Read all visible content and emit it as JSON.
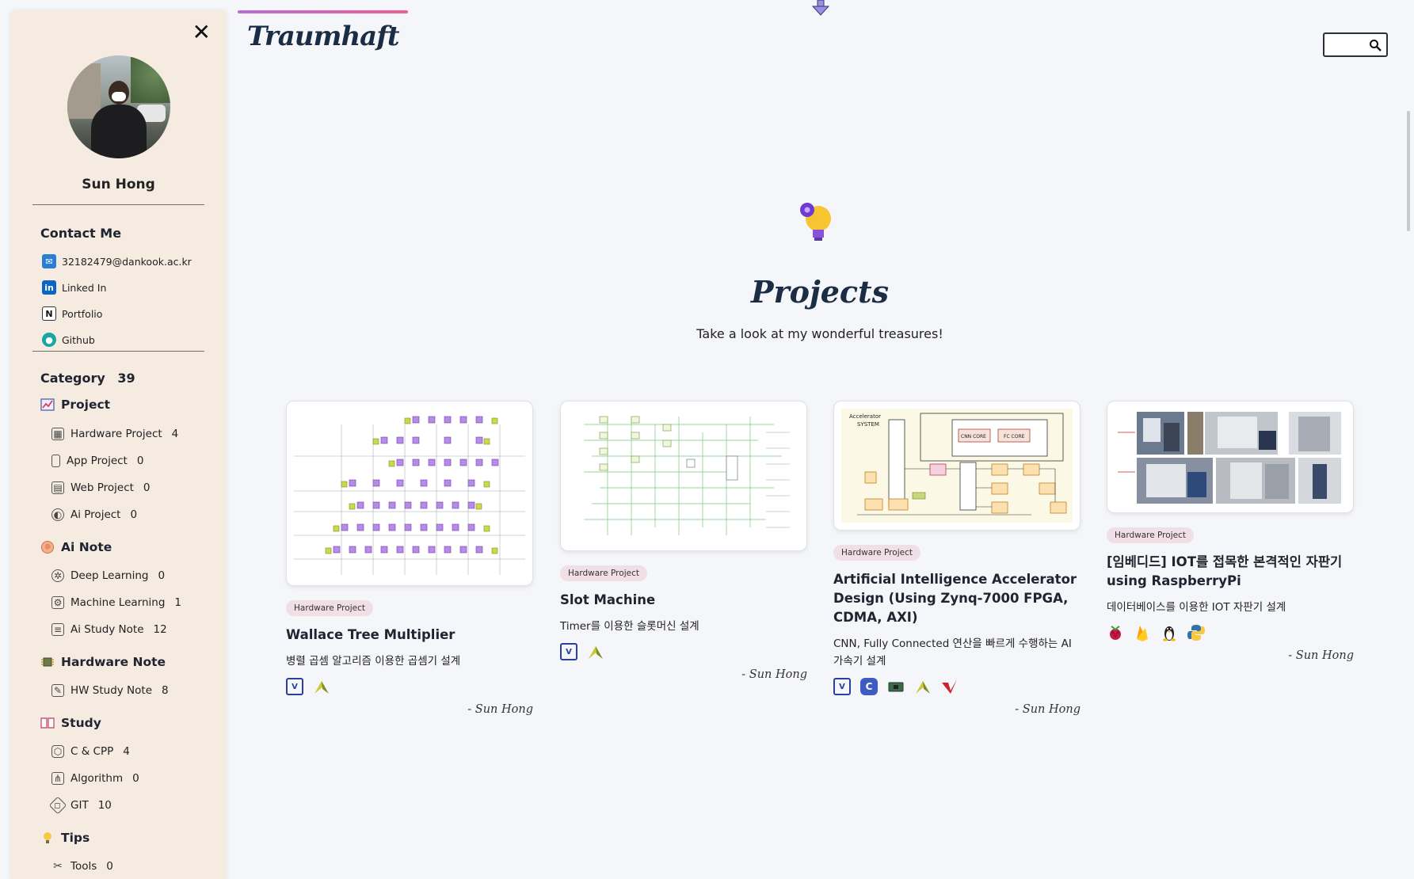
{
  "sidebar": {
    "close": "✕",
    "name": "Sun Hong",
    "contact_title": "Contact Me",
    "contacts": [
      {
        "label": "32182479@dankook.ac.kr",
        "icon": "mail-icon"
      },
      {
        "label": "Linked In",
        "icon": "linkedin-icon"
      },
      {
        "label": "Portfolio",
        "icon": "notion-icon"
      },
      {
        "label": "Github",
        "icon": "github-icon"
      }
    ],
    "category_title": "Category",
    "category_count": "39",
    "groups": [
      {
        "label": "Project",
        "icon": "chart-icon",
        "items": [
          {
            "label": "Hardware Project",
            "count": "4"
          },
          {
            "label": "App Project",
            "count": "0"
          },
          {
            "label": "Web Project",
            "count": "0"
          },
          {
            "label": "Ai Project",
            "count": "0"
          }
        ]
      },
      {
        "label": "Ai Note",
        "icon": "brain-icon",
        "items": [
          {
            "label": "Deep Learning",
            "count": "0"
          },
          {
            "label": "Machine Learning",
            "count": "1"
          },
          {
            "label": "Ai Study Note",
            "count": "12"
          }
        ]
      },
      {
        "label": "Hardware Note",
        "icon": "chip-icon",
        "items": [
          {
            "label": "HW Study Note",
            "count": "8"
          }
        ]
      },
      {
        "label": "Study",
        "icon": "book-icon",
        "items": [
          {
            "label": "C & CPP",
            "count": "4"
          },
          {
            "label": "Algorithm",
            "count": "0"
          },
          {
            "label": "GIT",
            "count": "10"
          }
        ]
      },
      {
        "label": "Tips",
        "icon": "lightbulb-icon",
        "items": [
          {
            "label": "Tools",
            "count": "0"
          }
        ]
      }
    ]
  },
  "header": {
    "logo": "Traumhaft",
    "search_placeholder": ""
  },
  "hero": {
    "title": "Projects",
    "subtitle": "Take a look at my wonderful treasures!"
  },
  "cards": [
    {
      "badge": "Hardware Project",
      "title": "Wallace Tree Multiplier",
      "desc": "병렬 곱셈 알고리즘 이용한 곱셈기 설계",
      "tech": [
        "verilog-icon",
        "vivado-icon"
      ],
      "author": "- Sun Hong"
    },
    {
      "badge": "Hardware Project",
      "title": "Slot Machine",
      "desc": "Timer를 이용한 슬롯머신 설계",
      "tech": [
        "verilog-icon",
        "vivado-icon"
      ],
      "author": "- Sun Hong"
    },
    {
      "badge": "Hardware Project",
      "title": "Artificial Intelligence Accelerator Design (Using Zynq-7000 FPGA, CDMA, AXI)",
      "desc": "CNN, Fully Connected 연산을 빠르게 수행하는 AI 가속기 설계",
      "tech": [
        "verilog-icon",
        "c-icon",
        "fpga-board-icon",
        "vivado-icon",
        "vitis-icon"
      ],
      "author": "- Sun Hong"
    },
    {
      "badge": "Hardware Project",
      "title": "[임베디드] IOT를 접목한 본격적인 자판기 using RaspberryPi",
      "desc": "데이터베이스를 이용한 IOT 자판기 설계",
      "tech": [
        "raspberrypi-icon",
        "firebase-icon",
        "linux-icon",
        "python-icon"
      ],
      "author": "- Sun Hong"
    }
  ]
}
